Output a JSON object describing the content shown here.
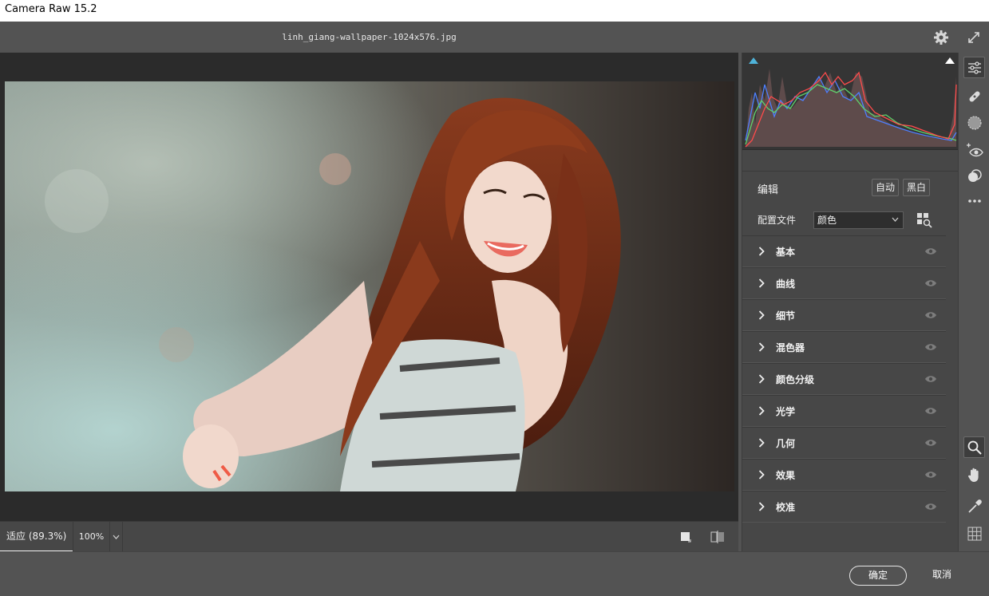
{
  "window": {
    "title": "Camera Raw 15.2"
  },
  "header": {
    "filename": "linh_giang-wallpaper-1024x576.jpg",
    "settings_icon": "gear-icon",
    "fullscreen_icon": "expand-icon"
  },
  "canvas_bar": {
    "zoom_fit_label": "适应 (89.3%)",
    "zoom_100_label": "100%"
  },
  "panel": {
    "edit_title": "编辑",
    "auto_label": "自动",
    "bw_label": "黑白",
    "profile_label": "配置文件",
    "profile_value": "颜色",
    "sections": [
      {
        "label": "基本"
      },
      {
        "label": "曲线"
      },
      {
        "label": "细节"
      },
      {
        "label": "混色器"
      },
      {
        "label": "颜色分级"
      },
      {
        "label": "光学"
      },
      {
        "label": "几何"
      },
      {
        "label": "效果"
      },
      {
        "label": "校准"
      }
    ]
  },
  "colors": {
    "accent": "#4fb3d9",
    "panel_bg": "#474747",
    "canvas_bg": "#2b2b2b"
  },
  "footer": {
    "ok_label": "确定",
    "cancel_label": "取消"
  }
}
